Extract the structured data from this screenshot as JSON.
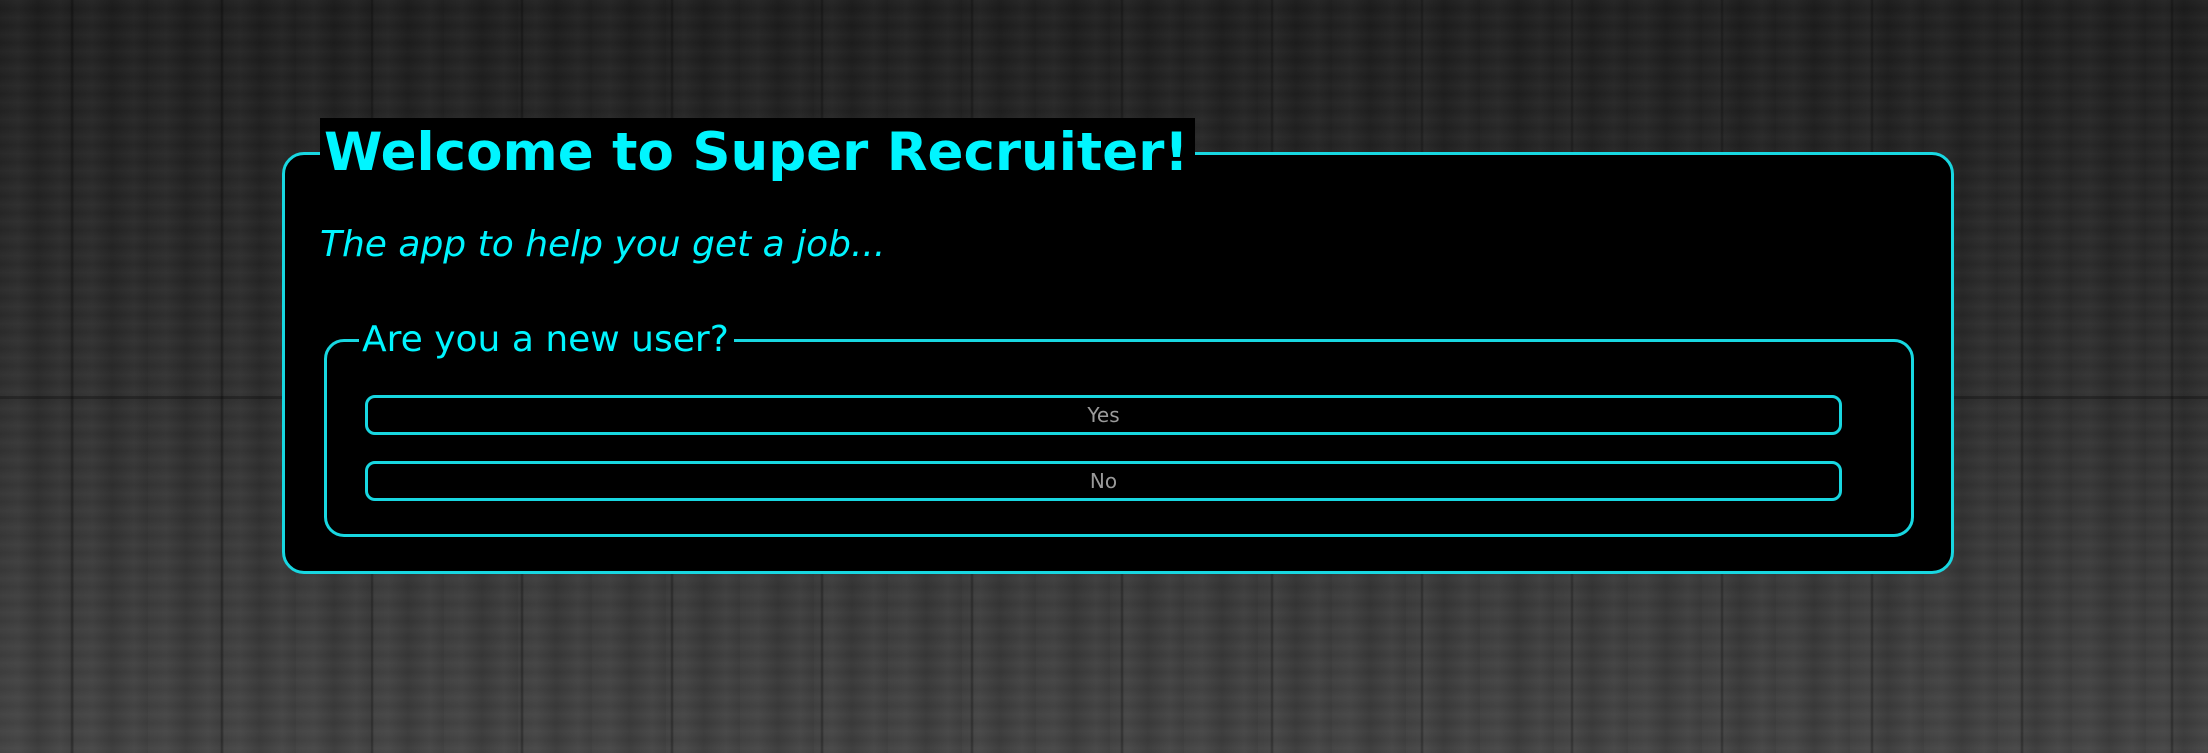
{
  "app": {
    "title": "Welcome to Super Recruiter!",
    "subtitle": "The app to help you get a job..."
  },
  "new_user_prompt": {
    "legend": "Are you a new user?",
    "yes_label": "Yes",
    "no_label": "No"
  },
  "colors": {
    "accent": "#00f5ff",
    "border": "#18d7e1",
    "panel_background": "#000000",
    "button_text": "#9a9a9a"
  }
}
